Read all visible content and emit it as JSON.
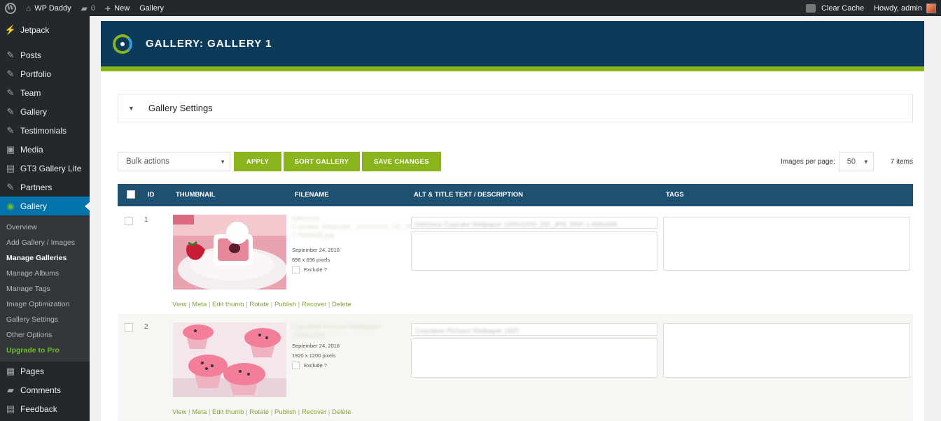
{
  "adminbar": {
    "site_name": "WP Daddy",
    "comments_count": "0",
    "new_label": "New",
    "gallery_label": "Gallery",
    "clear_cache": "Clear Cache",
    "howdy": "Howdy, admin"
  },
  "sidebar": {
    "items": [
      {
        "label": "Jetpack",
        "icon": "jetpack-icon"
      },
      {
        "label": "Posts",
        "icon": "pin-icon"
      },
      {
        "label": "Portfolio",
        "icon": "pin-icon"
      },
      {
        "label": "Team",
        "icon": "pin-icon"
      },
      {
        "label": "Gallery",
        "icon": "pin-icon"
      },
      {
        "label": "Testimonials",
        "icon": "pin-icon"
      },
      {
        "label": "Media",
        "icon": "media-icon"
      },
      {
        "label": "GT3 Gallery Lite",
        "icon": "gallery-icon"
      },
      {
        "label": "Partners",
        "icon": "pin-icon"
      },
      {
        "label": "Gallery",
        "icon": "nextgen-icon"
      }
    ],
    "submenu": [
      "Overview",
      "Add Gallery / Images",
      "Manage Galleries",
      "Manage Albums",
      "Manage Tags",
      "Image Optimization",
      "Gallery Settings",
      "Other Options",
      "Upgrade to Pro"
    ],
    "bottom_items": [
      {
        "label": "Pages",
        "icon": "pages-icon"
      },
      {
        "label": "Comments",
        "icon": "comments-icon"
      },
      {
        "label": "Feedback",
        "icon": "feedback-icon"
      }
    ]
  },
  "panel": {
    "title": "GALLERY: GALLERY 1",
    "settings_title": "Gallery Settings"
  },
  "toolbar": {
    "bulk_actions": "Bulk actions",
    "apply": "APPLY",
    "sort_gallery": "SORT GALLERY",
    "save_changes": "SAVE CHANGES",
    "images_per_page_label": "Images per page:",
    "images_per_page_value": "50",
    "items_count": "7 items"
  },
  "table": {
    "headers": {
      "id": "ID",
      "thumbnail": "THUMBNAIL",
      "filename": "FILENAME",
      "alt": "ALT & TITLE TEXT / DESCRIPTION",
      "tags": "TAGS"
    },
    "rows": [
      {
        "id": "1",
        "filename": "Delicious-Cupcake_Wallpaper_1920x1200_DD_JPG_RNF-1-696x696.jpg",
        "date": "September 24, 2018",
        "dimensions": "696 x 696 pixels",
        "exclude": "Exclude ?",
        "alt": "Delicious Cupcake Wallpaper 1920x1200_DD_JPG_RNF-1-696x696",
        "actions": [
          "View",
          "Meta",
          "Edit thumb",
          "Rotate",
          "Publish",
          "Recover",
          "Delete"
        ]
      },
      {
        "id": "2",
        "filename": "Cupcakes-Pictures-Wallpaper-1920x1200",
        "date": "September 24, 2018",
        "dimensions": "1920 x 1200 pixels",
        "exclude": "Exclude ?",
        "alt": "Cupcakes Pictures Wallpaper 1920",
        "actions": [
          "View",
          "Meta",
          "Edit thumb",
          "Rotate",
          "Publish",
          "Recover",
          "Delete"
        ]
      }
    ]
  },
  "colors": {
    "accent_green": "#8ab41b",
    "header_blue": "#0b3a5b",
    "table_head": "#1e5070",
    "wp_blue": "#0073aa"
  }
}
